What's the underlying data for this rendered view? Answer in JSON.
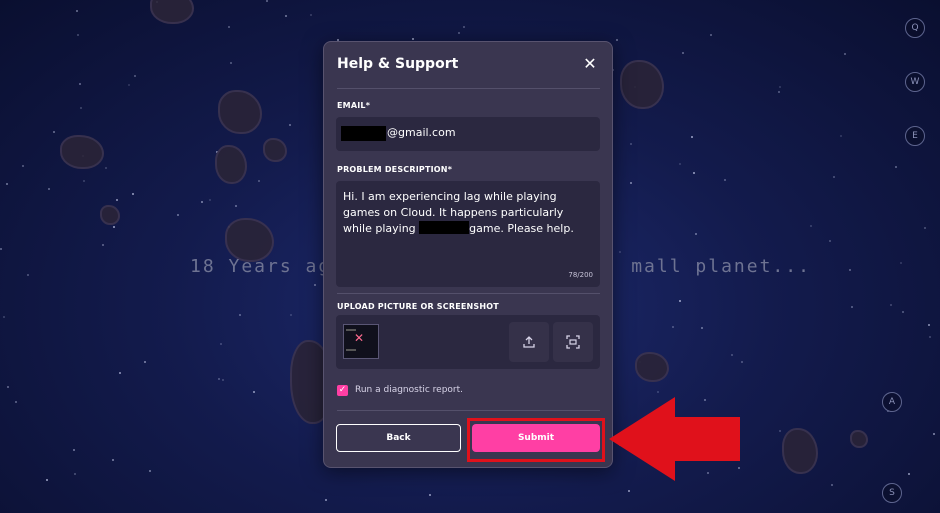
{
  "background": {
    "intro_left": "18 Years ag",
    "intro_right": "mall planet...",
    "key_hints": [
      "Q",
      "W",
      "E",
      "A",
      "S"
    ]
  },
  "modal": {
    "title": "Help & Support",
    "email_label": "EMAIL*",
    "email_value_visible": "@gmail.com",
    "description_label": "PROBLEM DESCRIPTION*",
    "description_part1": "Hi. I am experiencing lag while playing games on Cloud. It happens particularly while playing",
    "description_part2": "game. Please help.",
    "char_counter": "78/200",
    "upload_label": "UPLOAD PICTURE OR SCREENSHOT",
    "diagnostic_label": "Run a diagnostic report.",
    "diagnostic_checked": true,
    "back_label": "Back",
    "submit_label": "Submit"
  },
  "colors": {
    "accent_pink": "#ff3fa4",
    "annotation_red": "#e0111b",
    "modal_bg": "#3a3650"
  },
  "icons": [
    "close-icon",
    "upload-icon",
    "screenshot-icon",
    "checkmark-icon",
    "arrow-pointer-icon"
  ]
}
